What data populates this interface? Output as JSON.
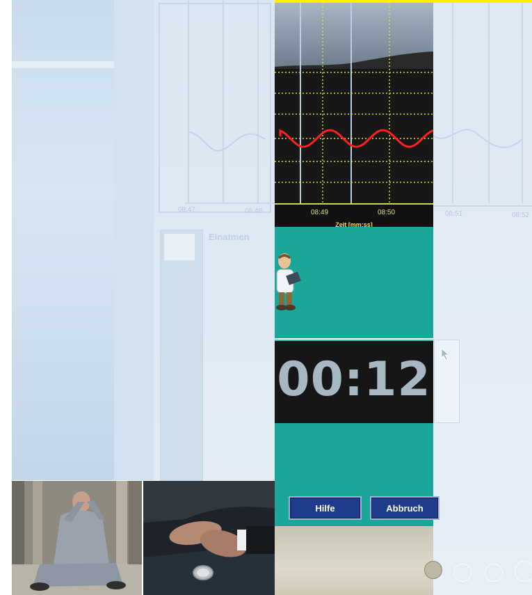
{
  "chart": {
    "tick_labels": [
      "08:49",
      "08:50"
    ],
    "axis_label": "Zeit [mm:ss]",
    "line_color": "#ff2020",
    "grid_color": "#d8e02a"
  },
  "background": {
    "tick_labels": [
      "08:47",
      "08:48",
      "08:51",
      "08:52"
    ],
    "section_label": "Einatmen"
  },
  "timer": {
    "value": "00:12"
  },
  "buttons": {
    "help_label": "Hilfe",
    "cancel_label": "Abbruch"
  },
  "colors": {
    "accent_yellow": "#ffef00",
    "teal": "#1aa79a",
    "button_blue": "#1f3c8a"
  }
}
